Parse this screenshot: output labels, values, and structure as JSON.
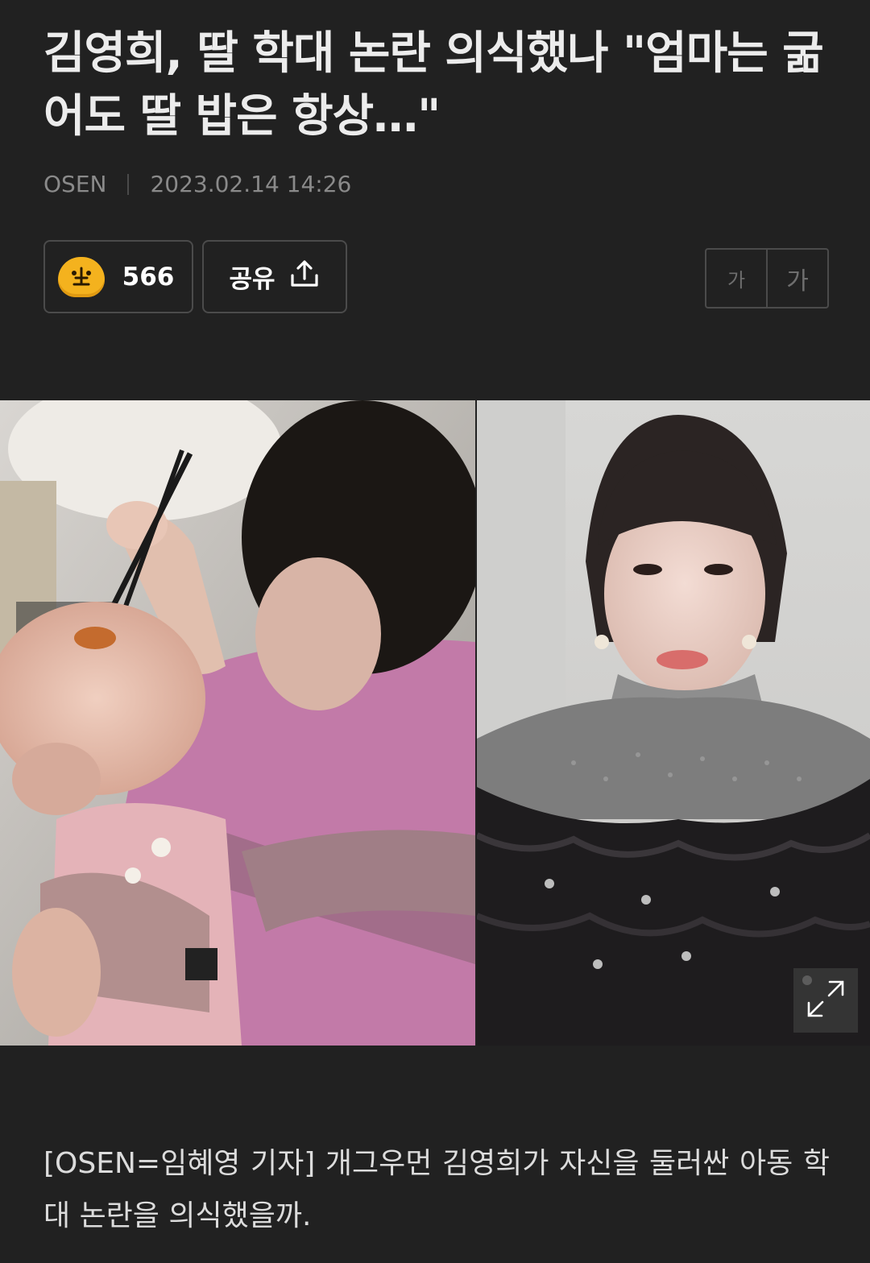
{
  "article": {
    "headline": "김영희, 딸 학대 논란 의식했나 \"엄마는 굶어도 딸 밥은 항상…\"",
    "source": "OSEN",
    "datetime": "2023.02.14 14:26",
    "body_first": "[OSEN=임혜영 기자] 개그우먼 김영희가 자신을 둘러싼 아동 학대 논란을 의식했을까."
  },
  "actions": {
    "reaction_count": "566",
    "reaction_icon": "reaction-emoji-icon",
    "share_label": "공유",
    "share_icon": "share-upload-icon"
  },
  "font_size": {
    "small_label": "가",
    "large_label": "가"
  },
  "photos": {
    "left_icon": "photo-mother-feeding-baby",
    "right_icon": "photo-woman-portrait",
    "expand_icon": "expand-icon"
  },
  "colors": {
    "background": "#212121",
    "border": "#4b4b4b",
    "emoji": "#f4b21e"
  }
}
